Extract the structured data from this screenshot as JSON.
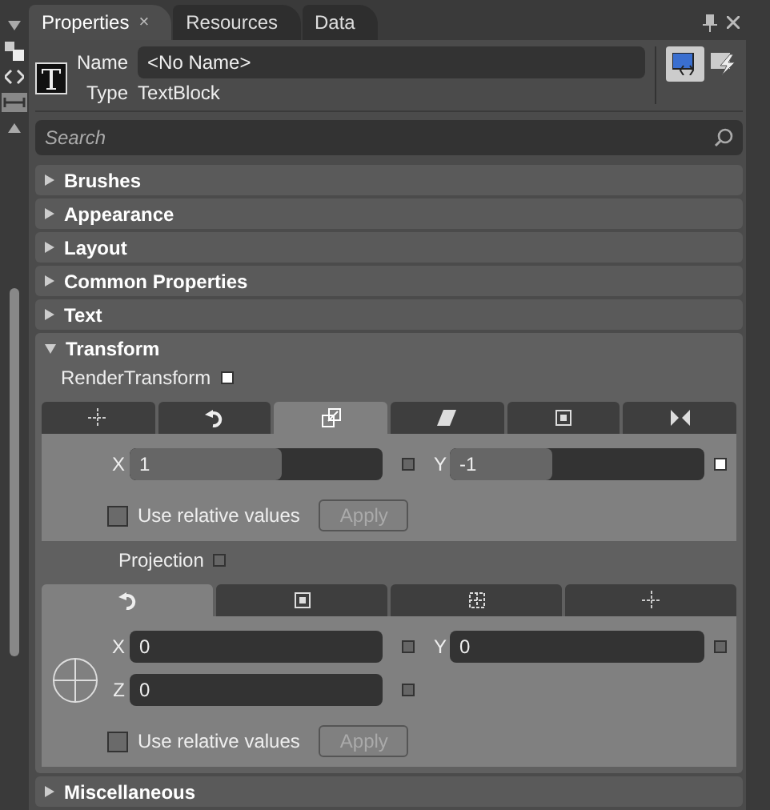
{
  "tabs": [
    {
      "label": "Properties",
      "selected": true,
      "close": "×"
    },
    {
      "label": "Resources",
      "selected": false
    },
    {
      "label": "Data",
      "selected": false
    }
  ],
  "header": {
    "name_label": "Name",
    "name_value": "<No Name>",
    "type_label": "Type",
    "type_value": "TextBlock",
    "view_buttons": [
      {
        "kind": "properties",
        "selected": true
      },
      {
        "kind": "events",
        "selected": false
      }
    ]
  },
  "search": {
    "placeholder": "Search"
  },
  "sections": [
    {
      "title": "Brushes",
      "expanded": false
    },
    {
      "title": "Appearance",
      "expanded": false
    },
    {
      "title": "Layout",
      "expanded": false
    },
    {
      "title": "Common Properties",
      "expanded": false
    },
    {
      "title": "Text",
      "expanded": false
    },
    {
      "title": "Transform",
      "expanded": true,
      "groups": [
        {
          "label": "RenderTransform",
          "set": true,
          "tabs": [
            {
              "kind": "translate",
              "selected": false
            },
            {
              "kind": "rotate",
              "selected": false
            },
            {
              "kind": "scale",
              "selected": true
            },
            {
              "kind": "skew",
              "selected": false
            },
            {
              "kind": "center",
              "selected": false
            },
            {
              "kind": "flip",
              "selected": false
            }
          ],
          "fields": [
            {
              "label": "X",
              "value": "1",
              "level": 0.6,
              "set": false
            },
            {
              "label": "Y",
              "value": "-1",
              "level": 0.4,
              "set": true
            }
          ],
          "relative": {
            "label": "Use relative values",
            "checked": false
          },
          "apply": {
            "label": "Apply",
            "disabled": true
          }
        },
        {
          "label": "Projection",
          "set": false,
          "globe": true,
          "tabs": [
            {
              "kind": "rotate",
              "selected": true
            },
            {
              "kind": "center",
              "selected": false
            },
            {
              "kind": "offset",
              "selected": false
            },
            {
              "kind": "translate",
              "selected": false
            }
          ],
          "fields": [
            {
              "label": "X",
              "value": "0",
              "set": false
            },
            {
              "label": "Y",
              "value": "0",
              "set": false
            },
            {
              "label": "Z",
              "value": "0",
              "set": false
            }
          ],
          "relative": {
            "label": "Use relative values",
            "checked": false
          },
          "apply": {
            "label": "Apply",
            "disabled": true
          }
        }
      ]
    },
    {
      "title": "Miscellaneous",
      "expanded": false
    }
  ]
}
